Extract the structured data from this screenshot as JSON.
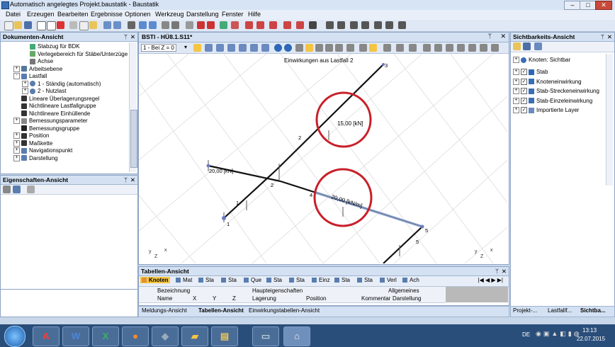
{
  "window": {
    "title": "Automatisch angelegtes Projekt.baustatik - Baustatik"
  },
  "menu": [
    "Datei",
    "Erzeugen",
    "Bearbeiten",
    "Ergebnisse",
    "Optionen",
    "Werkzeug",
    "Darstellung",
    "Fenster",
    "Hilfe"
  ],
  "doc_panel": {
    "title": "Dokumenten-Ansicht",
    "items": [
      {
        "label": "Stabzug für BDK",
        "indent": 1,
        "expander": ""
      },
      {
        "label": "Verlegebereich für Stäbe/Unterzüge",
        "indent": 1,
        "expander": ""
      },
      {
        "label": "Achse",
        "indent": 1,
        "expander": ""
      },
      {
        "label": "Arbeitsebene",
        "indent": 0,
        "expander": "+"
      },
      {
        "label": "Lastfall",
        "indent": 0,
        "expander": "-"
      },
      {
        "label": "1 - Ständig (automatisch)",
        "indent": 1,
        "expander": "+"
      },
      {
        "label": "2 - Nutzlast",
        "indent": 1,
        "expander": "+"
      },
      {
        "label": "Lineare Überlagerungsregel",
        "indent": 0,
        "expander": ""
      },
      {
        "label": "Nichtlineare Lastfallgruppe",
        "indent": 0,
        "expander": ""
      },
      {
        "label": "Nichtlineare Einhüllende",
        "indent": 0,
        "expander": ""
      },
      {
        "label": "Bemessungsparameter",
        "indent": 0,
        "expander": "+"
      },
      {
        "label": "Bemessungsgruppe",
        "indent": 0,
        "expander": ""
      },
      {
        "label": "Position",
        "indent": 0,
        "expander": "+"
      },
      {
        "label": "Maßkette",
        "indent": 0,
        "expander": "+"
      },
      {
        "label": "Navigationspunkt",
        "indent": 0,
        "expander": "+"
      },
      {
        "label": "Darstellung",
        "indent": 0,
        "expander": "+"
      }
    ]
  },
  "props_panel": {
    "title": "Eigenschaften-Ansicht"
  },
  "view": {
    "tab_label": "BSTI - HÜ8.1.S11*",
    "plane_select": "1 - Bei Z = 0",
    "caption": "Einwirkungen aus Lastfall 2",
    "loads": {
      "point": "15,00 [kN]",
      "line": "20,00 [kN/m]",
      "left": "20,00 [kN]"
    },
    "nodes": [
      "1",
      "2",
      "3",
      "4",
      "5",
      "6"
    ],
    "members": [
      "1",
      "2",
      "3",
      "4",
      "5"
    ],
    "axes": {
      "x": "x",
      "y": "y",
      "z": "Z"
    }
  },
  "visibility_panel": {
    "title": "Sichtbarkeits-Ansicht",
    "root": "Knoten:  Sichtbar",
    "items": [
      "Stab",
      "Knoteneinwirkung",
      "Stab-Streckeneinwirkung",
      "Stab-Einzeleinwirkung",
      "Importierte Layer"
    ],
    "bottom_tabs": [
      "Projekt-...",
      "Lastfallf...",
      "Sichtba..."
    ]
  },
  "table_panel": {
    "title": "Tabellen-Ansicht",
    "tabs": [
      "Knoten",
      "Mat",
      "Sta",
      "Sta",
      "Que",
      "Sta",
      "Sta",
      "Einz",
      "Sta",
      "Sta",
      "Verl",
      "Ach"
    ],
    "group_headers": [
      "Bezeichnung",
      "Haupteigenschaften",
      "Allgemeines"
    ],
    "columns": [
      "Name",
      "X",
      "Y",
      "Z",
      "Lagerung",
      "Position",
      "Kommentar",
      "Darstellung"
    ]
  },
  "bottom_tabs": [
    "Meldungs-Ansicht",
    "Tabellen-Ansicht",
    "Einwirkungstabellen-Ansicht"
  ],
  "taskbar": {
    "lang": "DE",
    "time": "13:13",
    "date": "22.07.2015"
  },
  "colors": {
    "accent": "#3a6fb5",
    "highlight_ring": "#c8202a",
    "selected_tab": "#f5c542"
  }
}
